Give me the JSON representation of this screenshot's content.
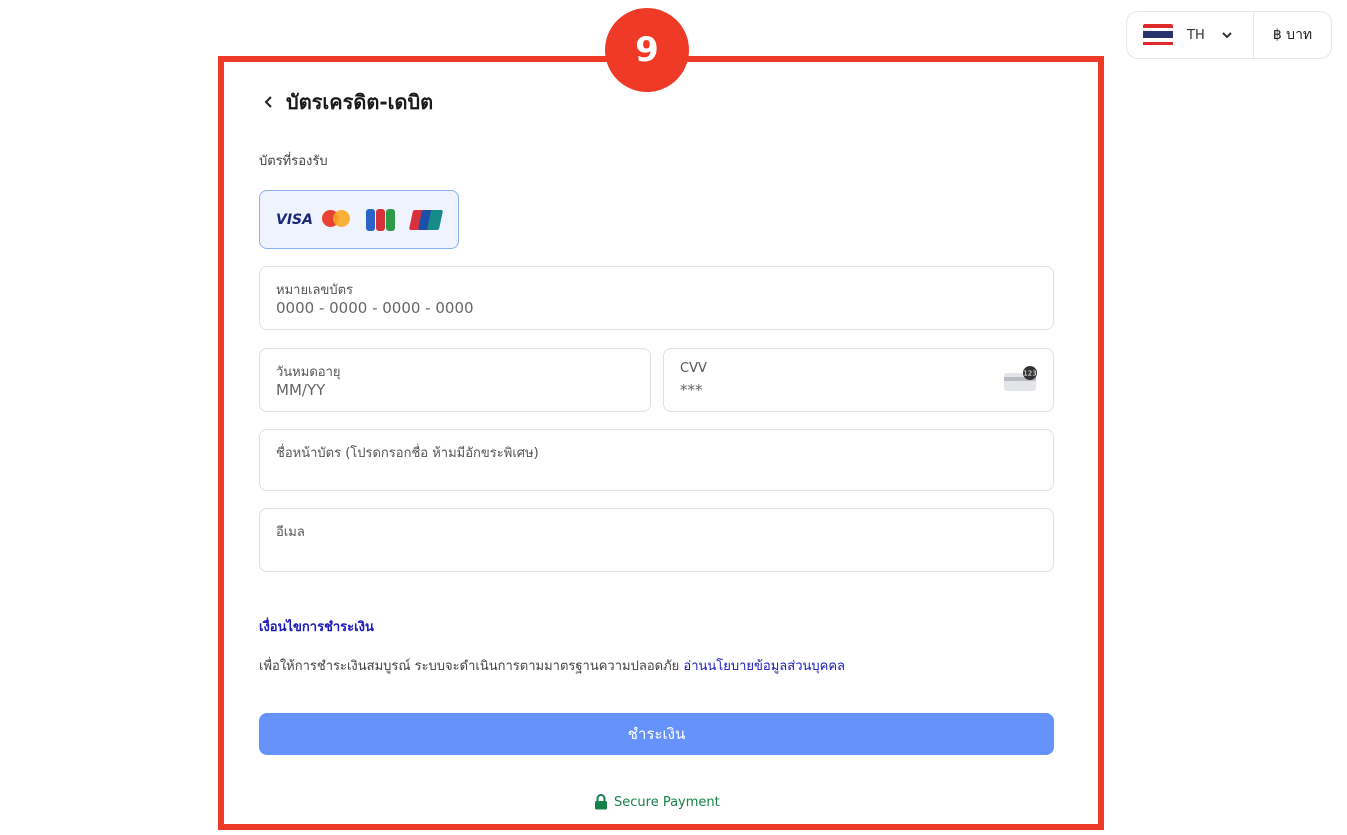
{
  "locale": {
    "language_code": "TH",
    "currency_label": "฿ บาท"
  },
  "step_badge": "9",
  "header": {
    "title": "บัตรเครดิต-เดบิต"
  },
  "supported_cards": {
    "label": "บัตรที่รองรับ",
    "brands": [
      "visa-logo",
      "mastercard-logo",
      "jcb-logo",
      "unionpay-logo"
    ],
    "visa_text": "VISA"
  },
  "form": {
    "card_number": {
      "label": "หมายเลขบัตร",
      "placeholder": "0000 - 0000 - 0000 - 0000"
    },
    "expiry": {
      "label": "วันหมดอายุ",
      "placeholder": "MM/YY"
    },
    "cvv": {
      "label": "CVV",
      "placeholder": "***"
    },
    "cardholder_name": {
      "label": "ชื่อหน้าบัตร (โปรดกรอกชื่อ ห้ามมีอักขระพิเศษ)",
      "value": ""
    },
    "email": {
      "label": "อีเมล",
      "value": ""
    }
  },
  "terms": {
    "title": "เงื่อนไขการชำระเงิน",
    "text": "เพื่อให้การชำระเงินสมบูรณ์ ระบบจะดำเนินการตามมาตรฐานความปลอดภัย ",
    "policy_link": "อ่านนโยบายข้อมูลส่วนบุคคล"
  },
  "pay_button": "ชำระเงิน",
  "secure_label": "Secure Payment",
  "colors": {
    "highlight": "#ee3a26",
    "primary_button": "#6592fb",
    "link": "#1b1bbd",
    "secure": "#16824a"
  }
}
